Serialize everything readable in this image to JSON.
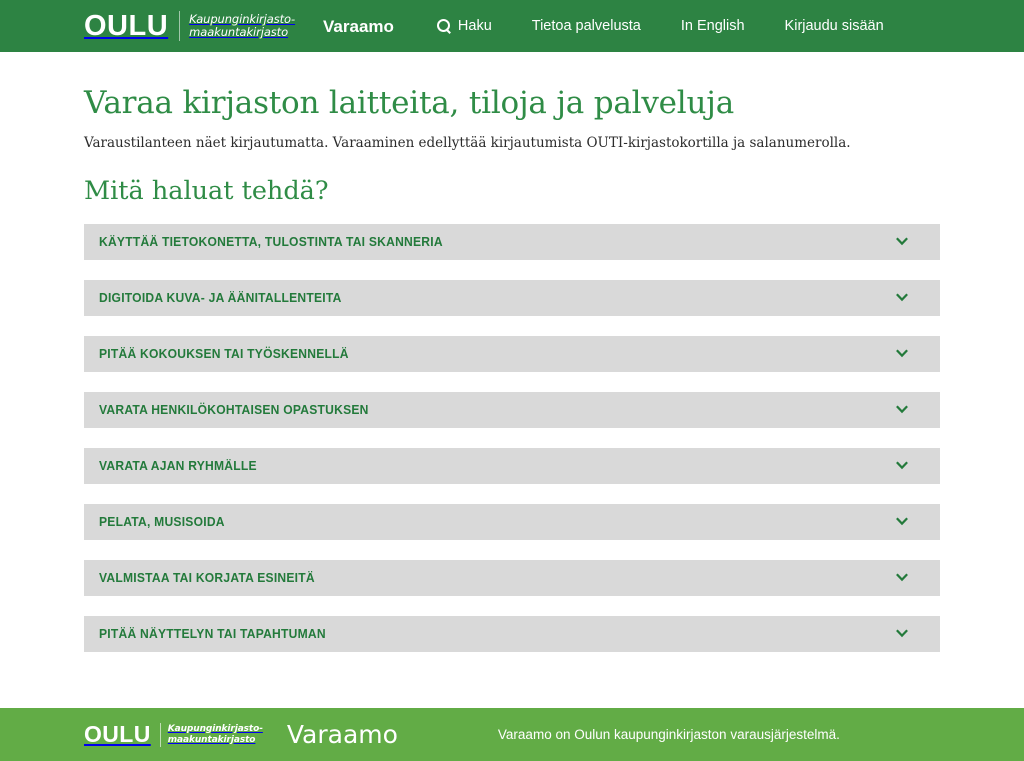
{
  "header": {
    "logo": {
      "primary": "OULU",
      "secondary_line1": "Kaupunginkirjasto-",
      "secondary_line2": "maakuntakirjasto"
    },
    "nav": [
      {
        "label": "Varaamo",
        "icon": null
      },
      {
        "label": "Haku",
        "icon": "search-icon"
      },
      {
        "label": "Tietoa palvelusta",
        "icon": null
      },
      {
        "label": "In English",
        "icon": null
      },
      {
        "label": "Kirjaudu sisään",
        "icon": null
      }
    ],
    "background_color": "#2d8343"
  },
  "main": {
    "page_title": "Varaa kirjaston laitteita, tiloja ja palveluja",
    "lead": "Varaustilanteen näet kirjautumatta. Varaaminen edellyttää kirjautumista OUTI-kirjastokortilla ja salanumerolla.",
    "section_title": "Mitä haluat tehdä?",
    "accordion": [
      {
        "label": "Käyttää tietokonetta, tulostinta tai skanneria",
        "expanded": false,
        "icon": "chevron-down-icon"
      },
      {
        "label": "Digitoida kuva- ja äänitallenteita",
        "expanded": false,
        "icon": "chevron-down-icon"
      },
      {
        "label": "Pitää kokouksen tai työskennellä",
        "expanded": false,
        "icon": "chevron-down-icon"
      },
      {
        "label": "Varata henkilökohtaisen opastuksen",
        "expanded": false,
        "icon": "chevron-down-icon"
      },
      {
        "label": "Varata ajan ryhmälle",
        "expanded": false,
        "icon": "chevron-down-icon"
      },
      {
        "label": "Pelata, musisoida",
        "expanded": false,
        "icon": "chevron-down-icon"
      },
      {
        "label": "Valmistaa tai korjata esineitä",
        "expanded": false,
        "icon": "chevron-down-icon"
      },
      {
        "label": "Pitää näyttelyn tai tapahtuman",
        "expanded": false,
        "icon": "chevron-down-icon"
      }
    ],
    "accent_color": "#2f8c46",
    "accordion_bar_color": "#d9d9d9",
    "accordion_text_color": "#237a3b"
  },
  "footer": {
    "logo": {
      "primary": "OULU",
      "secondary_line1": "Kaupunginkirjasto-",
      "secondary_line2": "maakuntakirjasto"
    },
    "service_name": "Varaamo",
    "tagline": "Varaamo on Oulun kaupunginkirjaston varausjärjestelmä.",
    "background_color": "#62ac46"
  }
}
